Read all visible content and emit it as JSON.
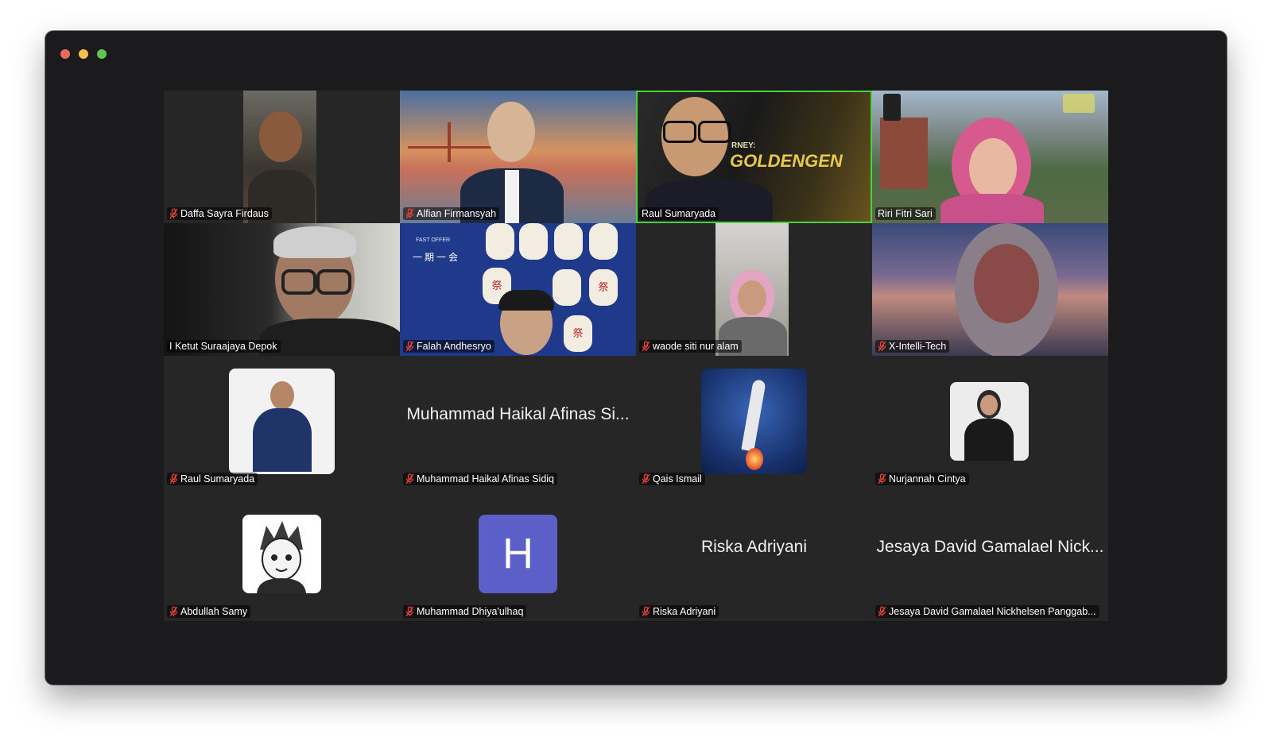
{
  "window": {
    "controls": [
      "close",
      "minimize",
      "zoom"
    ]
  },
  "gallery": {
    "active_speaker": "Raul Sumaryada",
    "tiles": [
      {
        "label": "Daffa Sayra Firdaus",
        "muted": true,
        "type": "video"
      },
      {
        "label": "Alfian Firmansyah",
        "muted": true,
        "type": "video"
      },
      {
        "label": "Raul Sumaryada",
        "muted": false,
        "type": "video",
        "bg_text": "GOLDENGEN",
        "bg_text_small": "RNEY:"
      },
      {
        "label": "Riri Fitri Sari",
        "muted": false,
        "type": "video"
      },
      {
        "label": "I Ketut Suraajaya Depok",
        "muted": false,
        "type": "video"
      },
      {
        "label": "Falah Andhesryo",
        "muted": true,
        "type": "video",
        "bg_text": "一期一会",
        "bg_text_small": "FAST OFFER",
        "lantern_text": "祭"
      },
      {
        "label": "waode siti nur alam",
        "muted": true,
        "type": "video"
      },
      {
        "label": "X-Intelli-Tech",
        "muted": true,
        "type": "video"
      },
      {
        "label": "Raul Sumaryada",
        "muted": true,
        "type": "avatar-photo"
      },
      {
        "label": "Muhammad Haikal Afinas Sidiq",
        "muted": true,
        "type": "name-only",
        "display_name": "Muhammad Haikal Afinas Si..."
      },
      {
        "label": "Qais Ismail",
        "muted": true,
        "type": "avatar-photo"
      },
      {
        "label": "Nurjannah Cintya",
        "muted": true,
        "type": "avatar-photo"
      },
      {
        "label": "Abdullah Samy",
        "muted": true,
        "type": "avatar-photo"
      },
      {
        "label": "Muhammad Dhiya'ulhaq",
        "muted": true,
        "type": "initial",
        "initial": "H"
      },
      {
        "label": "Riska Adriyani",
        "muted": true,
        "type": "name-only",
        "display_name": "Riska Adriyani"
      },
      {
        "label": "Jesaya David Gamalael Nickhelsen Panggab...",
        "muted": true,
        "type": "name-only",
        "display_name": "Jesaya David Gamalael Nick..."
      }
    ]
  },
  "colors": {
    "active_border": "#4bd23f",
    "mute_icon": "#e5423b",
    "tile_bg": "#262626",
    "window_bg": "#1b1b1d"
  }
}
